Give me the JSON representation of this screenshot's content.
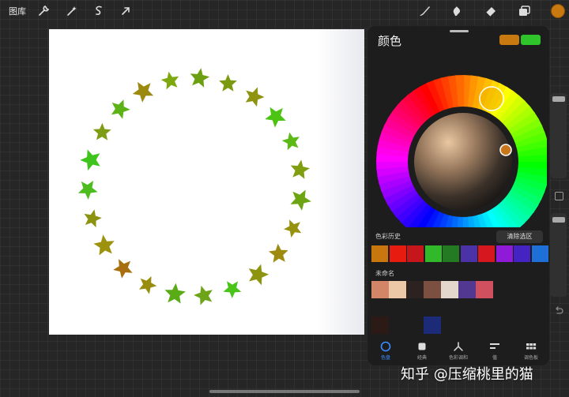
{
  "topbar": {
    "gallery_label": "图库",
    "left_icons": [
      "wrench-icon",
      "magic-wand-icon",
      "selection-icon",
      "transform-arrow-icon"
    ],
    "right_icons": [
      "brush-icon",
      "smudge-icon",
      "eraser-icon",
      "layers-icon"
    ],
    "current_color": "#c87a10"
  },
  "canvas": {
    "star_colors": [
      "#7a9a10",
      "#8f9410",
      "#4cc414",
      "#5cb916",
      "#7f9e10",
      "#6da413",
      "#96920e",
      "#9d8a0e",
      "#8d9410",
      "#4bc41a",
      "#6ea41a",
      "#5aac16",
      "#9a8d0e",
      "#a86f10",
      "#9d920e",
      "#8b9310",
      "#4bbd1c",
      "#3fc41e",
      "#7e9c14",
      "#5cb216",
      "#9c8a0f",
      "#7da810",
      "#6d9f12"
    ]
  },
  "color_panel": {
    "title": "颜色",
    "primary_swatch": "#c87a10",
    "secondary_swatch": "#2fc42a",
    "history_label": "色彩历史",
    "clear_button": "清除选区",
    "history_colors": [
      "#c8760e",
      "#e81b10",
      "#c4161b",
      "#31b92a",
      "#237a22",
      "#4b32a6",
      "#d61720",
      "#8f1ad8",
      "#4523c3",
      "#1e6fd6"
    ],
    "palette_label": "未命名",
    "palette_row1": [
      "#d28567",
      "#ecc8a6",
      "#2c2320",
      "#7b5040",
      "#e4d8cc",
      "#523890",
      "#d0505f"
    ],
    "palette_row2": [
      "#2c1a16",
      "",
      "",
      "#1b2b78"
    ],
    "tabs": [
      {
        "label": "色盘",
        "icon": "disc-icon",
        "active": true
      },
      {
        "label": "经典",
        "icon": "classic-square-icon",
        "active": false
      },
      {
        "label": "色彩调和",
        "icon": "harmony-icon",
        "active": false
      },
      {
        "label": "值",
        "icon": "value-sliders-icon",
        "active": false
      },
      {
        "label": "调色板",
        "icon": "palette-grid-icon",
        "active": false
      }
    ]
  },
  "watermark": "知乎 @压缩桃里的猫"
}
